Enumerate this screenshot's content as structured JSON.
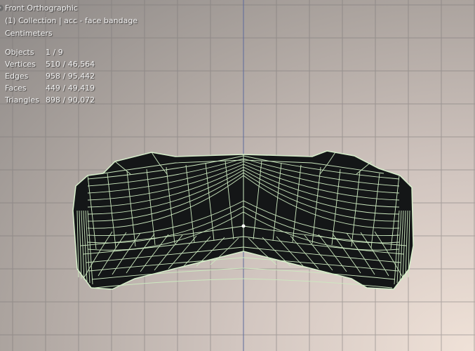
{
  "viewport": {
    "view_name": "Front Orthographic",
    "collection_info": "(1) Collection | acc - face bandage",
    "units": "Centimeters",
    "stats": [
      {
        "label": "Objects",
        "value": "1 / 9"
      },
      {
        "label": "Vertices",
        "value": "510 / 46,564"
      },
      {
        "label": "Edges",
        "value": "958 / 95,442"
      },
      {
        "label": "Faces",
        "value": "449 / 49,419"
      },
      {
        "label": "Triangles",
        "value": "898 / 90,072"
      }
    ]
  },
  "colors": {
    "wireframe": "#cdeac0",
    "mesh_fill": "#141617",
    "grid_line": "#7c7878",
    "z_axis": "#5c6a9c"
  }
}
